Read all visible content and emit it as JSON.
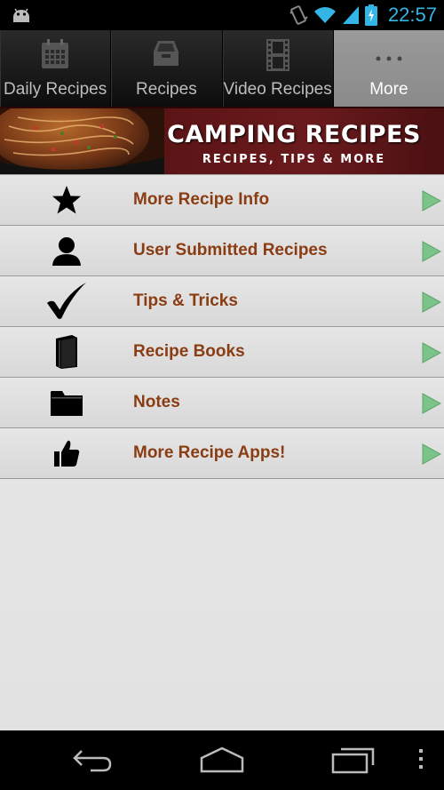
{
  "status_bar": {
    "time": "22:57",
    "icons": [
      "android-icon",
      "vibrate-icon",
      "wifi-icon",
      "signal-icon",
      "battery-icon"
    ]
  },
  "tabs": [
    {
      "label": "Daily Recipes",
      "icon": "calendar-icon",
      "active": false
    },
    {
      "label": "Recipes",
      "icon": "drawer-icon",
      "active": false
    },
    {
      "label": "Video Recipes",
      "icon": "film-icon",
      "active": false
    },
    {
      "label": "More",
      "icon": "more-dots-icon",
      "active": true
    }
  ],
  "banner": {
    "title": "CAMPING RECIPES",
    "subtitle": "RECIPES, TIPS & MORE"
  },
  "menu": [
    {
      "label": "More Recipe Info",
      "icon": "star-icon"
    },
    {
      "label": "User Submitted Recipes",
      "icon": "user-icon"
    },
    {
      "label": "Tips & Tricks",
      "icon": "checkmark-icon"
    },
    {
      "label": "Recipe Books",
      "icon": "book-icon"
    },
    {
      "label": "Notes",
      "icon": "folder-icon"
    },
    {
      "label": "More Recipe Apps!",
      "icon": "thumbs-up-icon"
    }
  ],
  "nav_bar": [
    "back-icon",
    "home-icon",
    "recent-apps-icon",
    "menu-overflow-icon"
  ],
  "colors": {
    "menu_text": "#8a3c12",
    "clock": "#33b5e5",
    "arrow": "#7cc38a",
    "banner": "#5a1416"
  }
}
